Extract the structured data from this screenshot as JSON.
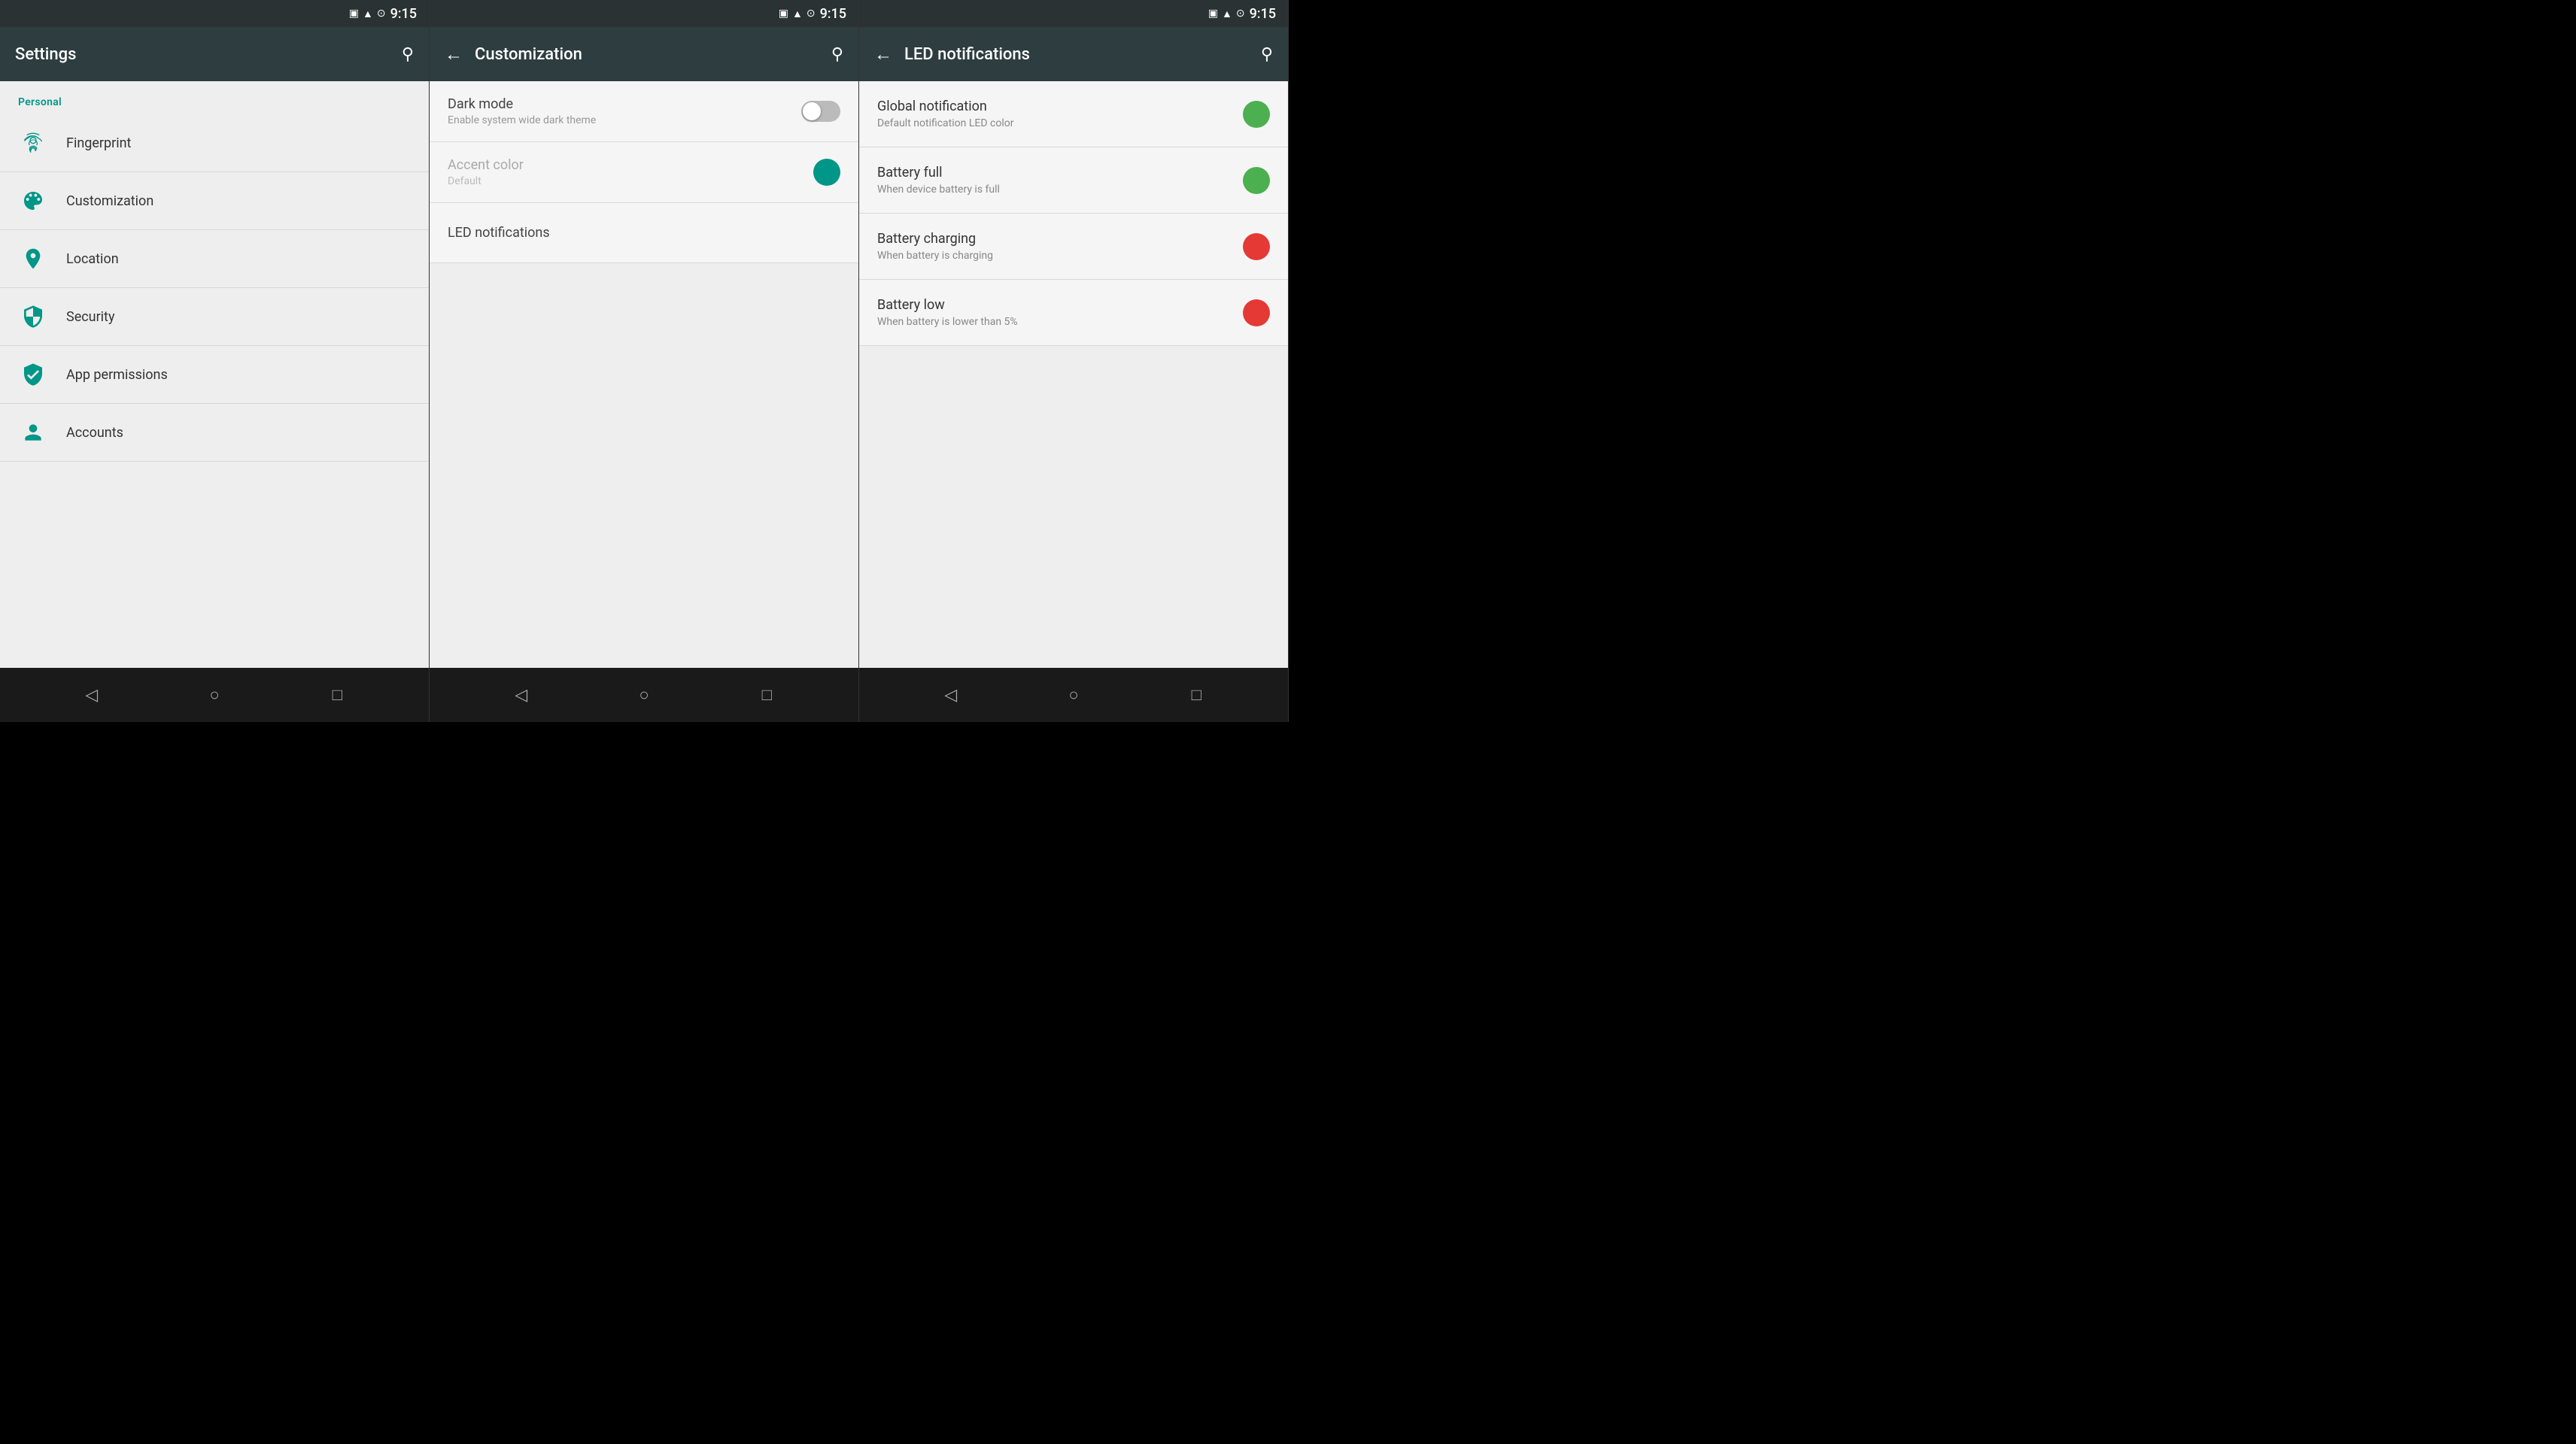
{
  "screens": {
    "settings": {
      "title": "Settings",
      "time": "9:15",
      "section_personal": "Personal",
      "items": [
        {
          "id": "fingerprint",
          "label": "Fingerprint",
          "icon": "fingerprint"
        },
        {
          "id": "customization",
          "label": "Customization",
          "icon": "customization"
        },
        {
          "id": "location",
          "label": "Location",
          "icon": "location"
        },
        {
          "id": "security",
          "label": "Security",
          "icon": "security"
        },
        {
          "id": "app_permissions",
          "label": "App permissions",
          "icon": "app_permissions"
        },
        {
          "id": "accounts",
          "label": "Accounts",
          "icon": "accounts"
        }
      ]
    },
    "customization": {
      "title": "Customization",
      "time": "9:15",
      "items": [
        {
          "id": "dark_mode",
          "title": "Dark mode",
          "subtitle": "Enable system wide dark theme",
          "type": "toggle",
          "enabled": false,
          "disabled": false
        },
        {
          "id": "accent_color",
          "title": "Accent color",
          "subtitle": "Default",
          "type": "dot",
          "disabled": true
        },
        {
          "id": "led_notifications",
          "title": "LED notifications",
          "subtitle": "",
          "type": "none",
          "disabled": false
        }
      ]
    },
    "led_notifications": {
      "title": "LED notifications",
      "time": "9:15",
      "items": [
        {
          "id": "global_notification",
          "title": "Global notification",
          "subtitle": "Default notification LED color",
          "color": "green"
        },
        {
          "id": "battery_full",
          "title": "Battery full",
          "subtitle": "When device battery is full",
          "color": "green"
        },
        {
          "id": "battery_charging",
          "title": "Battery charging",
          "subtitle": "When battery is charging",
          "color": "red"
        },
        {
          "id": "battery_low",
          "title": "Battery low",
          "subtitle": "When battery is lower than 5%",
          "color": "red"
        }
      ]
    }
  },
  "nav": {
    "back": "◁",
    "home": "○",
    "recents": "□"
  }
}
